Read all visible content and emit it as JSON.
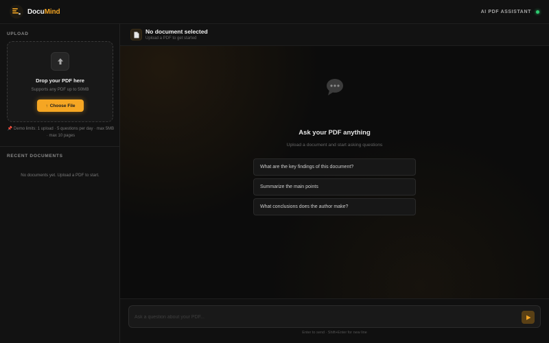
{
  "app": {
    "name_prefix": "Docu",
    "name_accent": "Mind",
    "assistant_label": "AI PDF ASSISTANT",
    "accent_color": "#f5a623",
    "status_color": "#2ecc71"
  },
  "sidebar": {
    "upload_title": "UPLOAD",
    "upload_icon": "arrow-up-icon",
    "drop_title": "Drop your PDF here",
    "drop_sub": "Supports any PDF up to 50MB",
    "choose_button_icon": "↑",
    "choose_button_label": "Choose File",
    "demo_limits_icon": "📌",
    "demo_limits": "Demo limits: 1 upload · 5 questions per day · max 5MB · max 10 pages",
    "recent_title": "RECENT DOCUMENTS",
    "no_documents": "No documents yet. Upload a PDF to start."
  },
  "document_header": {
    "icon": "document-icon",
    "title": "No document selected",
    "subtitle": "Upload a PDF to get started"
  },
  "chat": {
    "icon": "speech-bubble-icon",
    "title": "Ask your PDF anything",
    "subtitle": "Upload a document and start asking questions",
    "suggestions": [
      "What are the key findings of this document?",
      "Summarize the main points",
      "What conclusions does the author make?"
    ]
  },
  "composer": {
    "placeholder": "Ask a question about your PDF...",
    "send_icon": "send-icon",
    "hint": "Enter to send · Shift+Enter for new line"
  }
}
